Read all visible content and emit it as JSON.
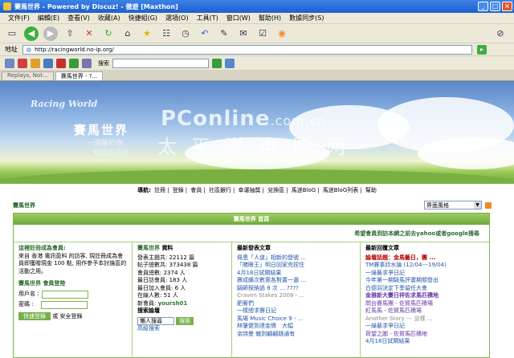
{
  "window": {
    "title": "賽馬世界 - Powered by Discuz! - 傲遊 [Maxthon]",
    "btn_min": "_",
    "btn_max": "□",
    "btn_close": "×"
  },
  "menu": [
    "文件(F)",
    "編輯(E)",
    "查看(V)",
    "收藏(A)",
    "快捷組(G)",
    "選項(O)",
    "工具(T)",
    "窗口(W)",
    "幫助(H)",
    "數據同步(S)"
  ],
  "address": {
    "label": "地址",
    "url": "http://racingworld.no-ip.org/",
    "go": "▸"
  },
  "searchbar": {
    "label": "搜索",
    "value": ""
  },
  "tabs": [
    "Replays, Not...",
    "賽馬世界 - ?..."
  ],
  "banner": {
    "logo": "Racing World",
    "cn_title": "賽馬世界",
    "sub1": "一個屬於你",
    "sub2": "和我的天地",
    "watermark_en": "PConline",
    "watermark_dom": ".com.cn",
    "watermark_cn": "太平洋电脑网"
  },
  "nav": {
    "prefix": "導航:",
    "sep": "|",
    "links": [
      "註冊",
      "登錄",
      "會員",
      "社區銀行",
      "幸運抽獎",
      "兌換區",
      "馬迷BloG",
      "馬迷BloG列表",
      "幫助"
    ]
  },
  "forum_name": "賽馬世界",
  "style_select": "界面風格",
  "board": {
    "head": "賽馬世界 首頁",
    "notice": "希望會員到訪本網之前去yahoo或者google搜尋",
    "col1": {
      "welcome_prefix": "這裡",
      "welcome_link": "註冊",
      "welcome_suffix": "成為會員:",
      "body": "來自 香港 電訊盈科 的訪客, 現註冊成為會員即獲贈現金 100 點, 用作參予本討論區的活動之用。",
      "login_title_a": "賽馬世界",
      "login_title_b": "會員登陸",
      "user_label": "用戶名 :",
      "pwd_label": "密碼 :",
      "login_btn": "快速登錄",
      "secure": "或 安全登錄"
    },
    "col2": {
      "title_a": "賽馬世界",
      "title_b": "資料",
      "stats": [
        "發表主題共: 22112 篇",
        "帖子總數共: 373438 篇",
        "會員總數: 2374 人",
        "最日訪會員: 183 人",
        "最日加入會員: 6 人",
        "在線人數: 51 人",
        "新會員: "
      ],
      "new_member": "yoursh01",
      "search_title": "搜索論壇",
      "search_select": "懶人搜尋",
      "search_btn": "搜索",
      "adv": "高級搜索"
    },
    "col3": {
      "title": "最新發表文章",
      "items": [
        "佩恩「人道」相新的發號 ...",
        "「賭眼王」明日回家完捏住",
        "4月18日試閘結果",
        "賽成績次數黨各對置一選 ...",
        "騎師探納過 8 次 ....????",
        "Craven Stakes 2008 - ...",
        "肥奢們",
        "一樣總求賽日記",
        "馬場 Music Choice 9 - ...",
        "林肇健到達金牌　大幅",
        "余詩曼 魅劍翩翩跳通有"
      ]
    },
    "col4": {
      "title": "最新回覆文章",
      "items": [
        "論壇話題：金馬藝日，團 ...",
        "TM賽事欣水論 (12/04---19/04)",
        "一綠藝求爭日記",
        "今年第一期騎馬評寶期頒發出",
        "白德羽決定下季留任大會",
        "金雅新大賽日祥佐求馬匹積地",
        "問台賽馬團 - 佐賀馬匹積場",
        "紅馬馬 - 佐賀馬匹積場",
        "Another Story --- 這樣 ...",
        "一綠藝求爭日記",
        "荷望之圖 - 佐賀馬匹積地",
        "4月18日試閘結果"
      ]
    }
  }
}
